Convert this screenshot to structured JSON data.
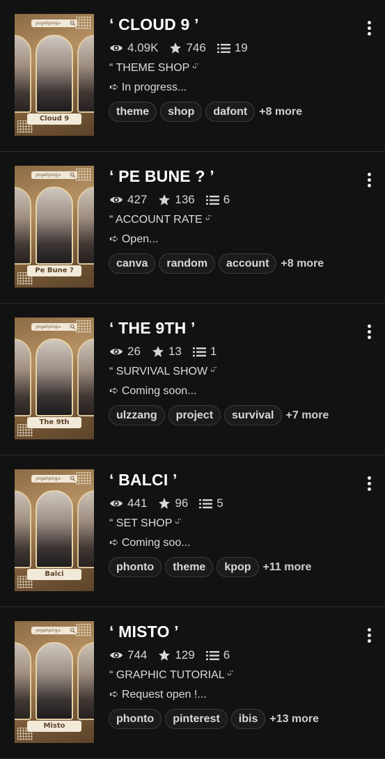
{
  "stories": [
    {
      "title": "‘ CLOUD 9 ’",
      "cover_text": "Cloud 9",
      "cover_bar": "yogahpingu-",
      "views": "4.09K",
      "votes": "746",
      "parts": "19",
      "line1": "“ THEME SHOP ᵕ̈",
      "line2": "➪ In progress...",
      "tags": [
        "theme",
        "shop",
        "dafont"
      ],
      "more": "+8 more"
    },
    {
      "title": "‘ PE BUNE ? ’",
      "cover_text": "Pe Bune ?",
      "cover_bar": "yogahpingu-",
      "views": "427",
      "votes": "136",
      "parts": "6",
      "line1": "“ ACCOUNT RATE ᵕ̈",
      "line2": "➪ Open...",
      "tags": [
        "canva",
        "random",
        "account"
      ],
      "more": "+8 more"
    },
    {
      "title": "‘ THE 9TH ’",
      "cover_text": "The 9th",
      "cover_bar": "yogahpingu-",
      "views": "26",
      "votes": "13",
      "parts": "1",
      "line1": "“ SURVIVAL SHOW ᵕ̈",
      "line2": "➪ Coming soon...",
      "tags": [
        "ulzzang",
        "project",
        "survival"
      ],
      "more": "+7 more"
    },
    {
      "title": "‘ BALCI ’",
      "cover_text": "Balci",
      "cover_bar": "yogahpingu-",
      "views": "441",
      "votes": "96",
      "parts": "5",
      "line1": "“ SET SHOP ᵕ̈",
      "line2": "➪ Coming soo...",
      "tags": [
        "phonto",
        "theme",
        "kpop"
      ],
      "more": "+11 more"
    },
    {
      "title": "‘ MISTO ’",
      "cover_text": "Misto",
      "cover_bar": "yogahpingu-",
      "views": "744",
      "votes": "129",
      "parts": "6",
      "line1": "“ GRAPHIC TUTORIAL ᵕ̈",
      "line2": "➪ Request open !...",
      "tags": [
        "phonto",
        "pinterest",
        "ibis"
      ],
      "more": "+13 more"
    }
  ],
  "icons": {
    "views": "eye-icon",
    "votes": "star-icon",
    "parts": "list-icon",
    "menu": "more-vertical-icon"
  }
}
